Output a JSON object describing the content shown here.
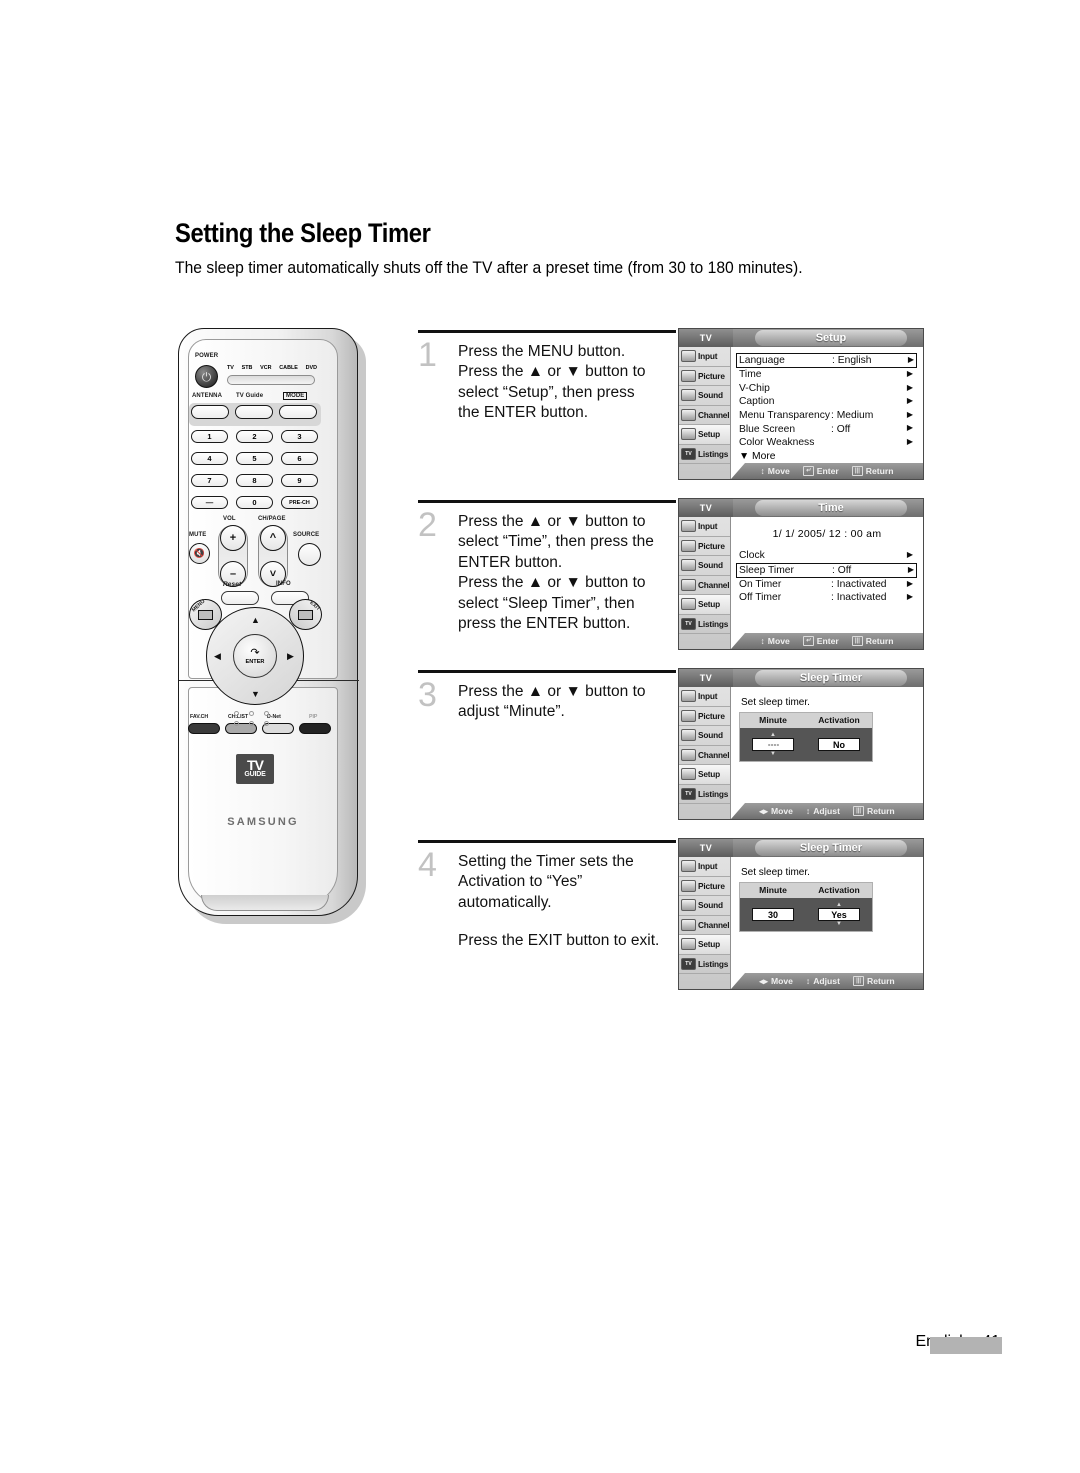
{
  "page": {
    "title": "Setting the Sleep Timer",
    "subtitle": "The sleep timer automatically shuts off the TV after a preset time (from 30 to 180 minutes).",
    "footer": "English - 41"
  },
  "remote": {
    "power_label": "POWER",
    "device_modes": [
      "TV",
      "STB",
      "VCR",
      "CABLE",
      "DVD"
    ],
    "antenna_label": "ANTENNA",
    "tvguide_label": "TV Guide",
    "mode_label": "MODE",
    "keypad": [
      "1",
      "2",
      "3",
      "4",
      "5",
      "6",
      "7",
      "8",
      "9",
      "—",
      "0",
      "PRE-CH"
    ],
    "vol_label": "VOL",
    "ch_label": "CH/PAGE",
    "mute_label": "MUTE",
    "source_label": "SOURCE",
    "reset_label": "Reset",
    "info_label": "INFO",
    "menu_label": "MENU",
    "exit_label": "EXIT",
    "enter_label": "ENTER",
    "bottom_buttons": [
      "FAV.CH",
      "CH.LIST",
      "D-Net",
      "PIP"
    ],
    "logo_top": "TV",
    "logo_bottom": "GUIDE",
    "brand": "SAMSUNG"
  },
  "steps": [
    {
      "number": "1",
      "lines": [
        "Press the MENU button.",
        "Press the ▲ or ▼ button to",
        "select “Setup”, then press",
        "the ENTER button."
      ]
    },
    {
      "number": "2",
      "lines": [
        "Press the ▲ or ▼ button to",
        "select “Time”, then press the",
        "ENTER button.",
        "Press the ▲ or ▼ button to",
        "select “Sleep Timer”, then",
        "press the ENTER button."
      ]
    },
    {
      "number": "3",
      "lines": [
        "Press the ▲ or ▼ button to",
        "adjust “Minute”."
      ]
    },
    {
      "number": "4",
      "lines": [
        "Setting the Timer sets the",
        "Activation to “Yes”",
        "automatically."
      ],
      "extra": "Press the EXIT button to exit."
    }
  ],
  "osd_common": {
    "tv_label": "TV",
    "sidebar": [
      {
        "label": "Input",
        "icon": "camcorder-icon"
      },
      {
        "label": "Picture",
        "icon": "monitor-icon"
      },
      {
        "label": "Sound",
        "icon": "speaker-icon"
      },
      {
        "label": "Channel",
        "icon": "antenna-icon"
      },
      {
        "label": "Setup",
        "icon": "tools-icon"
      },
      {
        "label": "Listings",
        "icon": "tvguide-icon"
      }
    ],
    "selected_sidebar": "Setup",
    "hint_move": "Move",
    "hint_enter": "Enter",
    "hint_return": "Return",
    "hint_adjust": "Adjust"
  },
  "osd_screens": [
    {
      "title": "Setup",
      "rows": [
        {
          "name": "Language",
          "value": ": English",
          "arrow": "▶",
          "boxed": true
        },
        {
          "name": "Time",
          "value": "",
          "arrow": "▶",
          "boxed": false
        },
        {
          "name": "V-Chip",
          "value": "",
          "arrow": "▶",
          "boxed": false
        },
        {
          "name": "Caption",
          "value": "",
          "arrow": "▶",
          "boxed": false
        },
        {
          "name": "Menu Transparency",
          "value": ": Medium",
          "arrow": "▶",
          "boxed": false
        },
        {
          "name": "Blue Screen",
          "value": ": Off",
          "arrow": "▶",
          "boxed": false
        },
        {
          "name": "Color Weakness",
          "value": "",
          "arrow": "▶",
          "boxed": false
        }
      ],
      "more": "▼ More",
      "hints": [
        "Move",
        "Enter",
        "Return"
      ]
    },
    {
      "title": "Time",
      "clock": "1/  1/ 2005/ 12 : 00 am",
      "rows": [
        {
          "name": "Clock",
          "value": "",
          "arrow": "▶",
          "boxed": false
        },
        {
          "name": "Sleep Timer",
          "value": ": Off",
          "arrow": "▶",
          "boxed": true
        },
        {
          "name": "On Timer",
          "value": ": Inactivated",
          "arrow": "▶",
          "boxed": false
        },
        {
          "name": "Off Timer",
          "value": ": Inactivated",
          "arrow": "▶",
          "boxed": false
        }
      ],
      "hints": [
        "Move",
        "Enter",
        "Return"
      ]
    },
    {
      "title": "Sleep Timer",
      "caption": "Set sleep timer.",
      "col_minute": "Minute",
      "col_activation": "Activation",
      "minute_value": "- - - -",
      "activation_value": "No",
      "focus": "minute",
      "hints": [
        "Move",
        "Adjust",
        "Return"
      ]
    },
    {
      "title": "Sleep Timer",
      "caption": "Set sleep timer.",
      "col_minute": "Minute",
      "col_activation": "Activation",
      "minute_value": "30",
      "activation_value": "Yes",
      "focus": "activation",
      "hints": [
        "Move",
        "Adjust",
        "Return"
      ]
    }
  ]
}
